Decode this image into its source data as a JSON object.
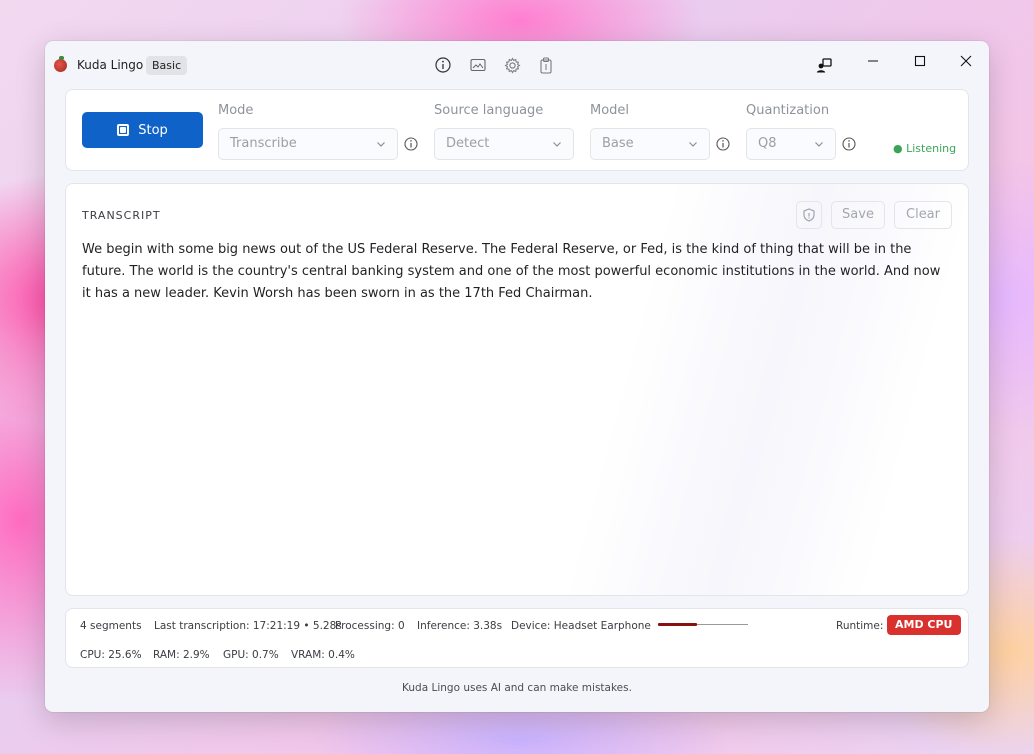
{
  "titlebar": {
    "app_name": "Kuda Lingo",
    "plan_badge": "Basic",
    "icons": [
      "info-icon",
      "image-icon",
      "gear-icon",
      "clipboard-icon",
      "user-switch-icon"
    ],
    "window_controls": [
      "minimize-icon",
      "maximize-icon",
      "close-icon"
    ]
  },
  "controls": {
    "stop_label": "Stop",
    "mode": {
      "label": "Mode",
      "value": "Transcribe"
    },
    "source_language": {
      "label": "Source language",
      "value": "Detect"
    },
    "model": {
      "label": "Model",
      "value": "Base"
    },
    "quantization": {
      "label": "Quantization",
      "value": "Q8"
    },
    "status": "● Listening",
    "status_color": "#3aa655"
  },
  "transcript": {
    "title": "TRANSCRIPT",
    "save_label": "Save",
    "clear_label": "Clear",
    "text": "We begin with some big news out of the US Federal Reserve. The Federal Reserve, or Fed, is the kind of thing that will be in the future. The world is the country's central banking system and one of the most powerful economic institutions in the world. And now it has a new leader. Kevin Worsh has been sworn in as the 17th Fed Chairman."
  },
  "status_bar": {
    "segments": "4 segments",
    "last_transcription": "Last transcription: 17:21:19 • 5.28s",
    "processing": "Processing: 0",
    "inference": "Inference: 3.38s",
    "device": "Device: Headset Earphone",
    "input_level": 0.43,
    "runtime_label": "Runtime:",
    "runtime_value": "AMD CPU",
    "runtime_color": "#d9312d",
    "cpu": "CPU: 25.6%",
    "ram": "RAM: 2.9%",
    "gpu": "GPU: 0.7%",
    "vram": "VRAM: 0.4%"
  },
  "footer": {
    "disclaimer": "Kuda Lingo uses AI and can make mistakes."
  },
  "colors": {
    "accent": "#0f62c7",
    "window_bg": "#f3f5fa"
  }
}
